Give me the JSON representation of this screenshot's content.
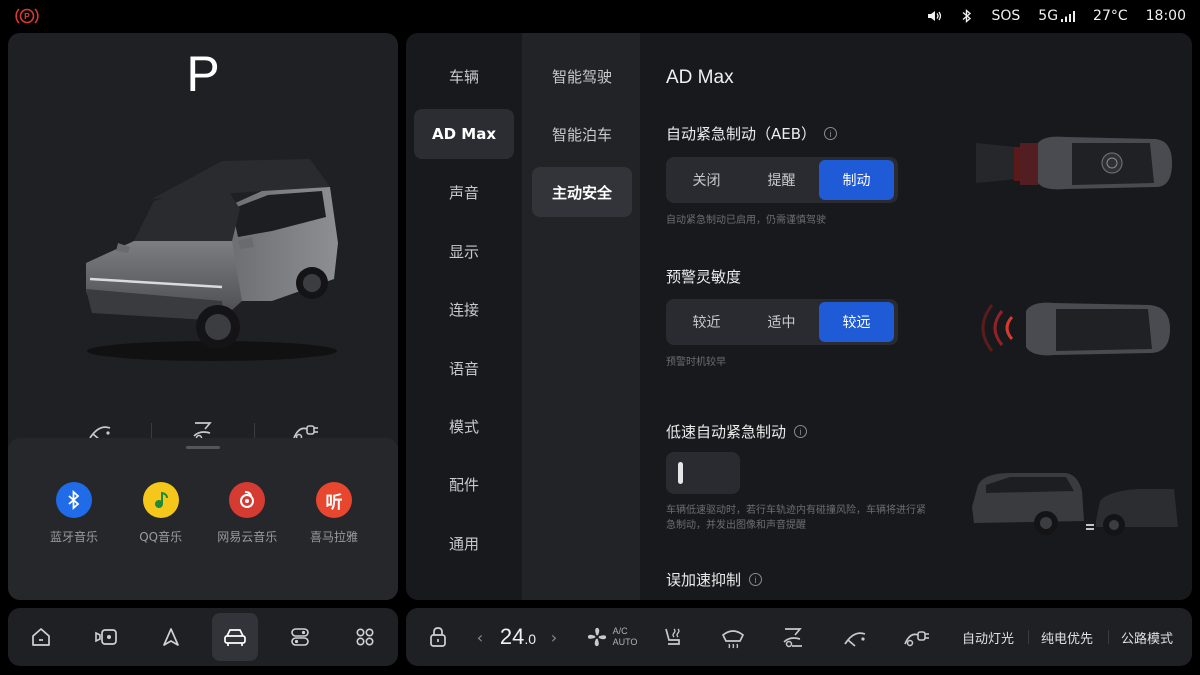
{
  "status": {
    "sos": "SOS",
    "network": "5G",
    "temperature": "27°C",
    "time": "18:00",
    "brake_color": "#d93a30"
  },
  "left": {
    "gear": "P",
    "apps": [
      {
        "label": "蓝牙音乐",
        "icon": "bluetooth-icon",
        "color": "#1f6be8"
      },
      {
        "label": "QQ音乐",
        "icon": "qq-music-icon",
        "color": "#f5c71a"
      },
      {
        "label": "网易云音乐",
        "icon": "netease-music-icon",
        "color": "#d53b31"
      },
      {
        "label": "喜马拉雅",
        "icon": "ximalaya-icon",
        "color": "#e8462e"
      }
    ]
  },
  "nav": {
    "level1": [
      "车辆",
      "AD Max",
      "声音",
      "显示",
      "连接",
      "语音",
      "模式",
      "配件",
      "通用"
    ],
    "level2": [
      "智能驾驶",
      "智能泊车",
      "主动安全"
    ]
  },
  "content": {
    "title": "AD Max",
    "aeb": {
      "title": "自动紧急制动（AEB）",
      "options": [
        "关闭",
        "提醒",
        "制动"
      ],
      "selected": "制动",
      "hint": "自动紧急制动已启用，仍需谨慎驾驶"
    },
    "sensitivity": {
      "title": "预警灵敏度",
      "options": [
        "较近",
        "适中",
        "较远"
      ],
      "selected": "较远",
      "hint": "预警时机较早"
    },
    "low_speed": {
      "title": "低速自动紧急制动",
      "enabled": false,
      "hint": "车辆低速驱动时，若行车轨迹内有碰撞风险，车辆将进行紧急制动，并发出图像和声音提醒"
    },
    "misaccel": {
      "title": "误加速抑制"
    },
    "accent": "#1f5bd6"
  },
  "dock": {
    "temp_value": "24",
    "temp_decimal": ".0",
    "ac_line1": "A/C",
    "ac_line2": "AUTO",
    "auto_light": "自动灯光",
    "ev_priority": "纯电优先",
    "road_mode": "公路模式"
  }
}
